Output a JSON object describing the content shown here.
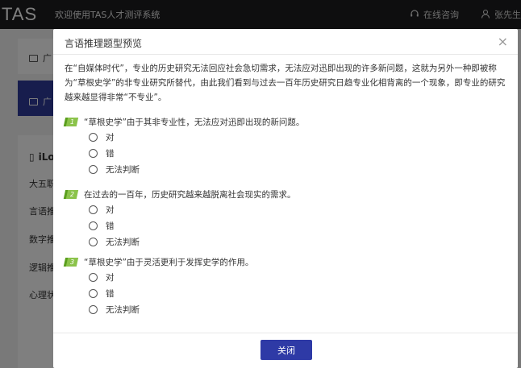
{
  "topbar": {
    "logo": "TAS",
    "welcome": "欢迎使用TAS人才测评系统",
    "consult": "在线咨询",
    "user": "张先生"
  },
  "background": {
    "items": [
      {
        "label": "广"
      },
      {
        "label": "广"
      },
      {
        "label": "iLo"
      },
      {
        "label": "大五职"
      },
      {
        "label": "言语推"
      },
      {
        "label": "数字推"
      },
      {
        "label": "逻辑推"
      },
      {
        "label": "心理状"
      }
    ]
  },
  "modal": {
    "title": "言语推理题型预览",
    "close_icon": "×",
    "passage": "在“自媒体时代”，专业的历史研究无法回应社会急切需求，无法应对迅即出现的许多新问题，这就为另外一种即被称为“草根史学”的非专业研究所替代，由此我们看到与过去一百年历史研究日趋专业化相背离的一个现象，即专业的研究越来越显得非常“不专业”。",
    "questions": [
      {
        "num": "1",
        "text": "“草根史学”由于其非专业性，无法应对迅即出现的新问题。",
        "options": [
          "对",
          "错",
          "无法判断"
        ]
      },
      {
        "num": "2",
        "text": "在过去的一百年，历史研究越来越脱离社会现实的需求。",
        "options": [
          "对",
          "错",
          "无法判断"
        ]
      },
      {
        "num": "3",
        "text": "“草根史学”由于灵活更利于发挥史学的作用。",
        "options": [
          "对",
          "错",
          "无法判断"
        ]
      }
    ],
    "close_button": "关闭"
  },
  "colors": {
    "primary": "#2e3aa6",
    "badge": "#8bc34a",
    "topbar": "#1d1d1f"
  }
}
